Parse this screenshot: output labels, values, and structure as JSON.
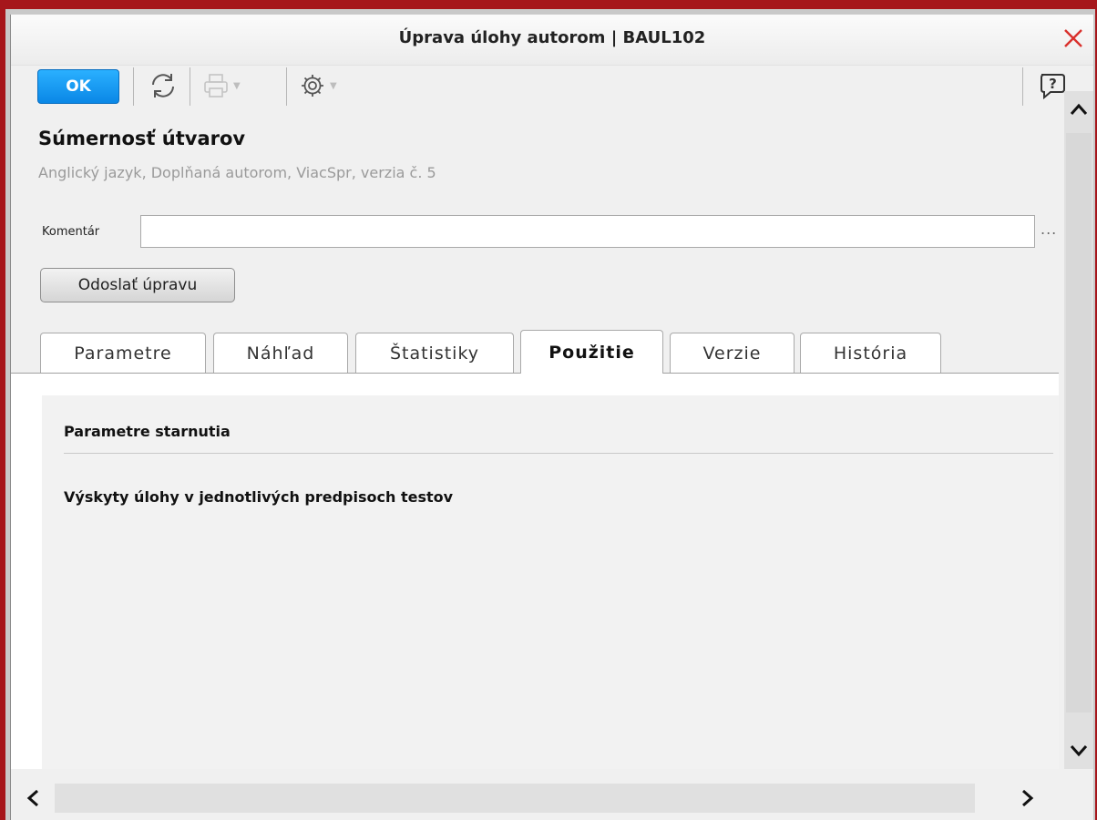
{
  "window": {
    "title": "Úprava úlohy autorom | BAUL102"
  },
  "toolbar": {
    "ok_label": "OK",
    "icons": [
      "refresh-icon",
      "print-icon",
      "gear-icon",
      "help-icon"
    ]
  },
  "item": {
    "title": "Súmernosť útvarov",
    "subtitle": "Anglický jazyk, Doplňaná autorom, ViacSpr, verzia č. 5"
  },
  "comment": {
    "label": "Komentár",
    "value": "",
    "more_label": "..."
  },
  "send_button_label": "Odoslať úpravu",
  "tabs": [
    {
      "label": "Parametre",
      "active": false
    },
    {
      "label": "Náhľad",
      "active": false
    },
    {
      "label": "Štatistiky",
      "active": false
    },
    {
      "label": "Použitie",
      "active": true
    },
    {
      "label": "Verzie",
      "active": false
    },
    {
      "label": "História",
      "active": false
    }
  ],
  "content": {
    "section1": "Parametre starnutia",
    "section2": "Výskyty úlohy v jednotlivých predpisoch testov"
  },
  "colors": {
    "accent": "#1a9cf0",
    "close": "#d9302c",
    "outer_border": "#a6161b"
  }
}
